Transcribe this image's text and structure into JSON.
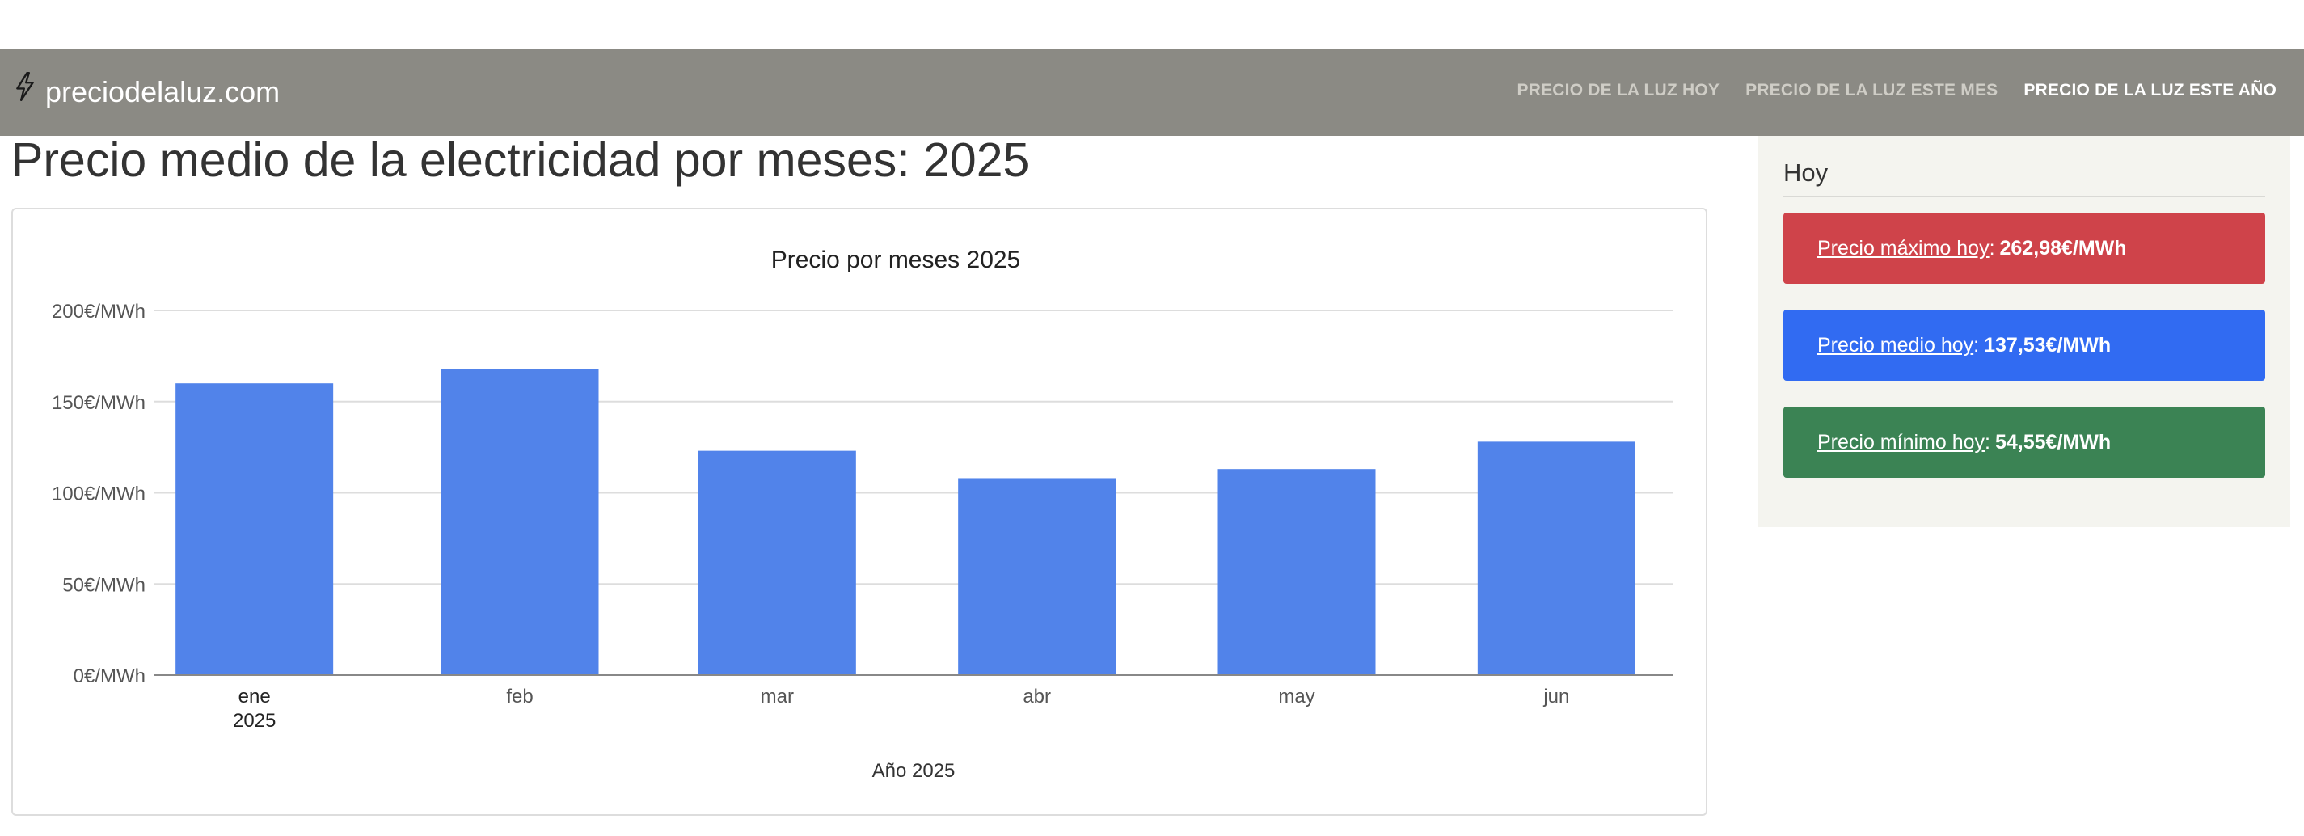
{
  "brand": {
    "name": "preciodelaluz.com",
    "icon": "lightning-bolt-icon"
  },
  "nav": {
    "items": [
      {
        "label": "PRECIO DE LA LUZ HOY",
        "active": false
      },
      {
        "label": "PRECIO DE LA LUZ ESTE MES",
        "active": false
      },
      {
        "label": "PRECIO DE LA LUZ ESTE AÑO",
        "active": true
      }
    ]
  },
  "page": {
    "title": "Precio medio de la electricidad por meses: 2025"
  },
  "sidebar": {
    "title": "Hoy",
    "boxes": [
      {
        "link": "Precio máximo hoy",
        "sep": ":",
        "value": "262,98€/MWh",
        "color": "#cf434a"
      },
      {
        "link": "Precio medio hoy",
        "sep": ":",
        "value": "137,53€/MWh",
        "color": "#316bf2"
      },
      {
        "link": "Precio mínimo hoy",
        "sep": ":",
        "value": "54,55€/MWh",
        "color": "#3b8354"
      }
    ]
  },
  "chart_data": {
    "type": "bar",
    "title": "Precio por meses 2025",
    "xlabel": "Año 2025",
    "ylabel": "",
    "categories": [
      "ene",
      "feb",
      "mar",
      "abr",
      "may",
      "jun"
    ],
    "year_sublabel": "2025",
    "values": [
      160,
      168,
      123,
      108,
      113,
      128
    ],
    "ylim": [
      0,
      200
    ],
    "yticks": [
      "0€/MWh",
      "50€/MWh",
      "100€/MWh",
      "150€/MWh",
      "200€/MWh"
    ],
    "ytick_values": [
      0,
      50,
      100,
      150,
      200
    ],
    "bar_color": "#5183ea",
    "grid": true,
    "legend": false
  }
}
